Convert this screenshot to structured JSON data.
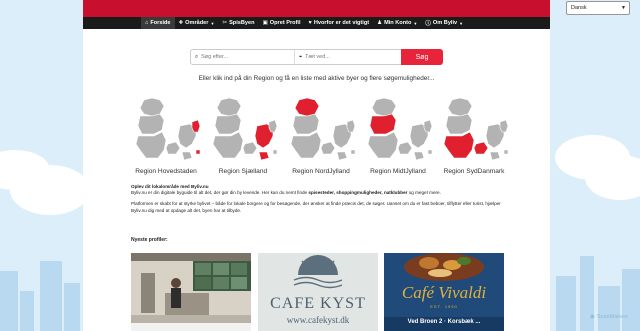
{
  "colors": {
    "brand_red": "#c8102e",
    "nav_bg": "#1b1b1b",
    "search_button": "#e8243a",
    "region_highlight": "#e1202f",
    "map_gray": "#b3b3b3"
  },
  "language": {
    "selected": "Dansk"
  },
  "nav": [
    {
      "label": "Forside",
      "icon": "home-icon",
      "glyph": "⌂",
      "dropdown": false,
      "active": true
    },
    {
      "label": "Områder",
      "icon": "map-icon",
      "glyph": "✚",
      "dropdown": true,
      "active": false
    },
    {
      "label": "SpisByen",
      "icon": "fork-icon",
      "glyph": "✂",
      "dropdown": false,
      "active": false
    },
    {
      "label": "Opret Profil",
      "icon": "plus-icon",
      "glyph": "▣",
      "dropdown": false,
      "active": false
    },
    {
      "label": "Hvorfor er det vigtigt",
      "icon": "heart-icon",
      "glyph": "♥",
      "dropdown": false,
      "active": false
    },
    {
      "label": "Min Konto",
      "icon": "user-icon",
      "glyph": "♟",
      "dropdown": true,
      "active": false
    },
    {
      "label": "Om Byliv",
      "icon": "info-icon",
      "glyph": "ⓘ",
      "dropdown": true,
      "active": false
    }
  ],
  "search": {
    "what_placeholder": "Søg efter...",
    "where_placeholder": "Tæt ved...",
    "button": "Søg"
  },
  "lead_text": "Eller klik ind på din Region og få en liste med aktive byer og flere søgemuligheder...",
  "regions": [
    {
      "label": "Region Hovedstaden",
      "highlight": "hovedstaden"
    },
    {
      "label": "Region Sjælland",
      "highlight": "sjaelland"
    },
    {
      "label": "Region NordJylland",
      "highlight": "nordjylland"
    },
    {
      "label": "Region MidtJylland",
      "highlight": "midtjylland"
    },
    {
      "label": "Region SydDanmark",
      "highlight": "syddanmark"
    }
  ],
  "info": {
    "heading": "Oplev dit lokalområde med Byliv.nu",
    "p1_before": "Byliv.nu er din digitale byguide til alt det, der gør din by levende. Her kan du nemt finde ",
    "p1_bold": "spisesteder, shoppingmuligheder, natklubber",
    "p1_after": " og meget mere.",
    "p2": "Platformen er skabt for at styrke bylivet – både for lokale borgere og for besøgende, der ønsker at finde præcis det, de søger. Uanset om du er fast beboer, tilflytter eller turist, hjælper Byliv.nu dig med at opdage alt det, byen har at tilbyde."
  },
  "profiles_heading": "Nyeste profiler:",
  "profiles": [
    {
      "name": "profile-card-showroom"
    },
    {
      "name": "profile-card-cafe-kyst",
      "title": "CAFE KYST",
      "url": "www.cafekyst.dk"
    },
    {
      "name": "profile-card-cafe-vivaldi",
      "title": "Café Vivaldi",
      "sub": "EST. 1990",
      "address": "Ved Broen 2 · Korsbæk ..."
    }
  ],
  "watermark": "ScanMakers"
}
